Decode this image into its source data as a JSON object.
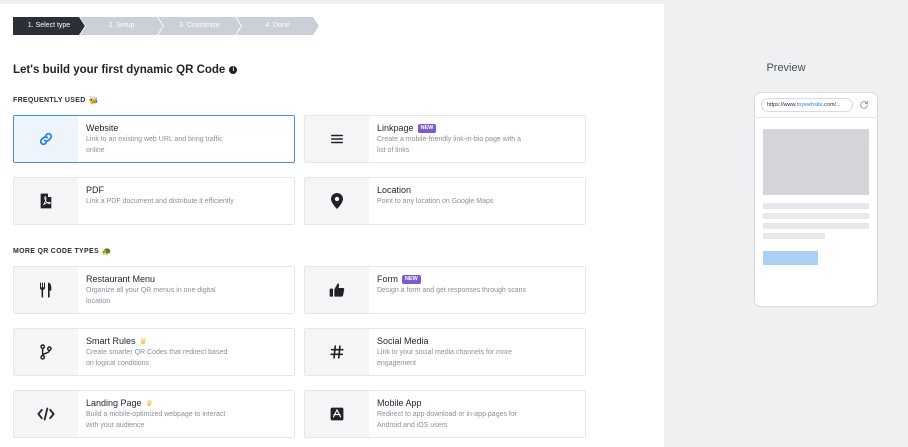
{
  "stepper": {
    "steps": [
      "1. Select type",
      "2. Setup",
      "3. Customize",
      "4. Done"
    ],
    "active_index": 0
  },
  "main": {
    "title": "Let's build your first dynamic QR Code",
    "section_frequent": "FREQUENTLY USED",
    "section_more": "MORE QR CODE TYPES",
    "badge_new": "NEW",
    "cards": {
      "website": {
        "title": "Website",
        "desc": "Link to an existing web URL and bring traffic online",
        "icon": "link-icon"
      },
      "linkpage": {
        "title": "Linkpage",
        "desc": "Create a mobile-friendly link-in-bio page with a list of links",
        "icon": "list-icon"
      },
      "pdf": {
        "title": "PDF",
        "desc": "Link a PDF document and distribute it efficiently",
        "icon": "pdf-icon"
      },
      "location": {
        "title": "Location",
        "desc": "Point to any location on Google Maps",
        "icon": "map-pin-icon"
      },
      "restaurant": {
        "title": "Restaurant Menu",
        "desc": "Organize all your QR menus in one digital location",
        "icon": "fork-knife-icon"
      },
      "form": {
        "title": "Form",
        "desc": "Design a form and get responses through scans",
        "icon": "thumbs-up-icon"
      },
      "smartrules": {
        "title": "Smart Rules",
        "desc": "Create smarter QR Codes that redirect based on logical conditions",
        "icon": "branch-icon"
      },
      "social": {
        "title": "Social Media",
        "desc": "Link to your social media channels for more engagement",
        "icon": "hashtag-icon"
      },
      "landing": {
        "title": "Landing Page",
        "desc": "Build a mobile-optimized webpage to interact with your audience",
        "icon": "code-icon"
      },
      "mobileapp": {
        "title": "Mobile App",
        "desc": "Redirect to app download or in-app pages for Android and iOS users",
        "icon": "app-store-icon"
      }
    }
  },
  "preview": {
    "title": "Preview",
    "url_prefix": "https://www.",
    "url_domain": "mywebsite",
    "url_suffix": ".com/..."
  },
  "colors": {
    "accent": "#4a90d9",
    "step_active": "#2b3038",
    "step_pending": "#c9d0d8",
    "badge_new": "#7b5ccf",
    "crown": "#f2b91f"
  }
}
